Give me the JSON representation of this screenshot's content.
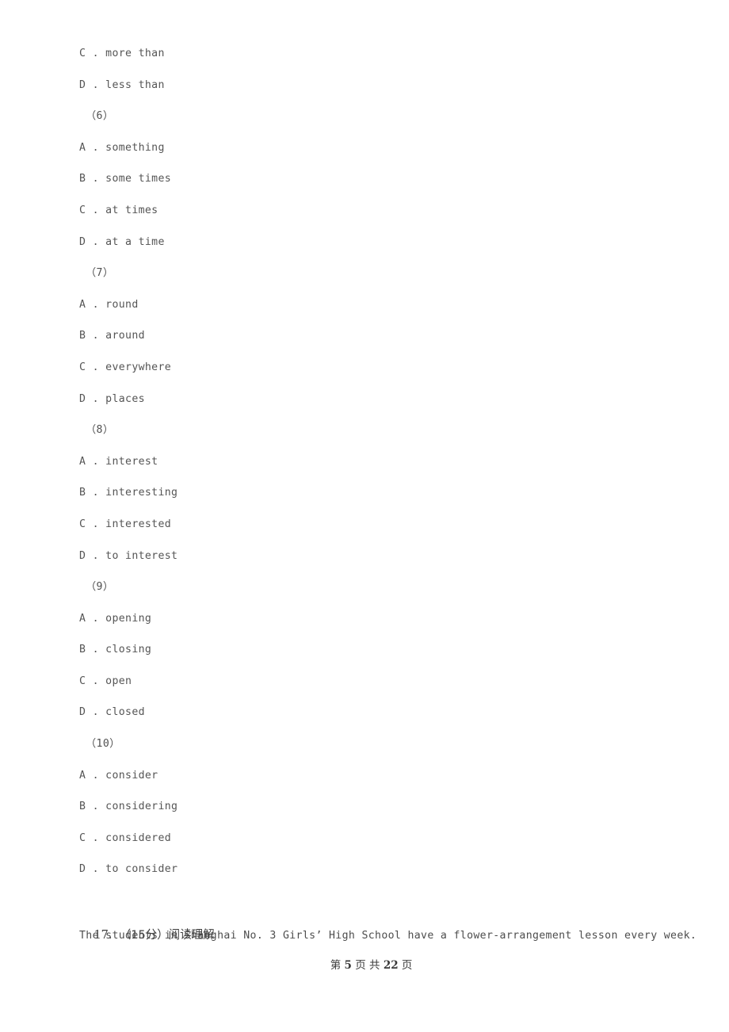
{
  "document": {
    "type": "exam-paper",
    "background_color": "#ffffff",
    "text_color": "#555555"
  },
  "body_lines": [
    {
      "kind": "option",
      "text": "C . more than"
    },
    {
      "kind": "option",
      "text": "D . less than"
    },
    {
      "kind": "question",
      "text": "（6）"
    },
    {
      "kind": "option",
      "text": "A . something"
    },
    {
      "kind": "option",
      "text": "B . some times"
    },
    {
      "kind": "option",
      "text": "C . at times"
    },
    {
      "kind": "option",
      "text": "D . at a time"
    },
    {
      "kind": "question",
      "text": "（7）"
    },
    {
      "kind": "option",
      "text": "A . round"
    },
    {
      "kind": "option",
      "text": "B . around"
    },
    {
      "kind": "option",
      "text": "C . everywhere"
    },
    {
      "kind": "option",
      "text": "D . places"
    },
    {
      "kind": "question",
      "text": "（8）"
    },
    {
      "kind": "option",
      "text": "A . interest"
    },
    {
      "kind": "option",
      "text": "B . interesting"
    },
    {
      "kind": "option",
      "text": "C . interested"
    },
    {
      "kind": "option",
      "text": "D . to interest"
    },
    {
      "kind": "question",
      "text": "（9）"
    },
    {
      "kind": "option",
      "text": "A . opening"
    },
    {
      "kind": "option",
      "text": "B . closing"
    },
    {
      "kind": "option",
      "text": "C . open"
    },
    {
      "kind": "option",
      "text": "D . closed"
    },
    {
      "kind": "question",
      "text": "（10）"
    },
    {
      "kind": "option",
      "text": "A . consider"
    },
    {
      "kind": "option",
      "text": "B . considering"
    },
    {
      "kind": "option",
      "text": "C . considered"
    },
    {
      "kind": "option",
      "text": "D . to consider"
    }
  ],
  "section": {
    "number": "17.",
    "score": "（15分）",
    "title": "阅读理解"
  },
  "passage": {
    "text": "The students in Shanghai No. 3 Girls’ High School have a flower-arrangement lesson every week."
  },
  "footer": {
    "prefix": "第",
    "current_page": "5",
    "middle": "页 共",
    "total_pages": "22",
    "suffix": "页"
  }
}
